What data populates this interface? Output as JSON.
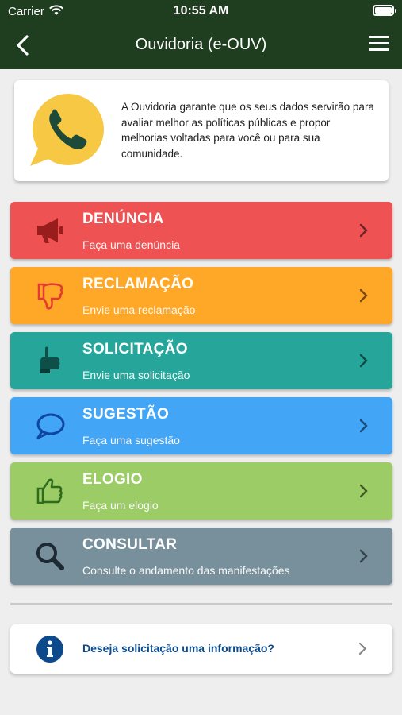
{
  "status_bar": {
    "carrier": "Carrier",
    "time": "10:55 AM"
  },
  "nav": {
    "title": "Ouvidoria (e-OUV)"
  },
  "info": {
    "text": "A Ouvidoria garante que os seus dados servirão para avaliar melhor as políticas públicas e propor melhorias voltadas para você ou para sua comunidade."
  },
  "options": [
    {
      "title": "DENÚNCIA",
      "subtitle": "Faça uma denúncia",
      "color": "#ee5253",
      "icon": "megaphone-icon"
    },
    {
      "title": "RECLAMAÇÃO",
      "subtitle": "Envie uma reclamação",
      "color": "#ffa726",
      "icon": "thumbs-down-icon"
    },
    {
      "title": "SOLICITAÇÃO",
      "subtitle": "Envie uma solicitação",
      "color": "#26a69a",
      "icon": "pointing-hand-icon"
    },
    {
      "title": "SUGESTÃO",
      "subtitle": "Faça uma sugestão",
      "color": "#42a5f5",
      "icon": "speech-bubble-icon"
    },
    {
      "title": "ELOGIO",
      "subtitle": "Faça um elogio",
      "color": "#9ccc65",
      "icon": "thumbs-up-icon"
    },
    {
      "title": "CONSULTAR",
      "subtitle": "Consulte o andamento das manifestações",
      "color": "#78909c",
      "icon": "search-icon"
    }
  ],
  "help": {
    "text": "Deseja solicitação uma informação?"
  },
  "colors": {
    "header": "#1f3d1f",
    "background": "#eeeeee",
    "phone_badge": "#f7c843",
    "info_icon": "#0c4a8c"
  }
}
